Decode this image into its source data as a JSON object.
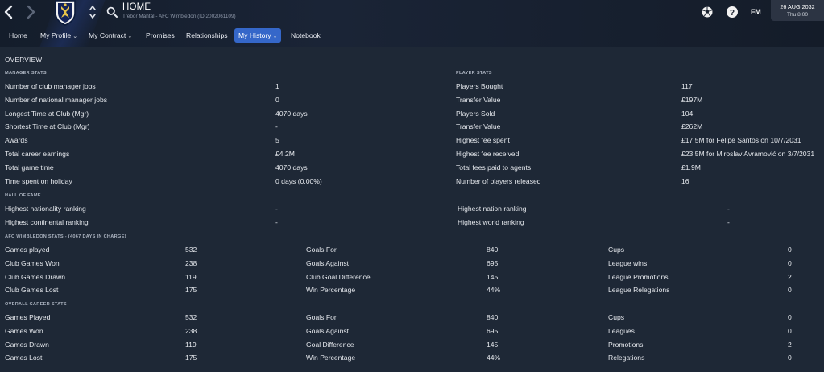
{
  "header": {
    "title": "HOME",
    "subtitle": "Trebor Mahtal - AFC Wimbledon (ID:2002061109)",
    "brand": "FM",
    "date": "26 AUG 2032",
    "time": "Thu 8:00"
  },
  "menu": [
    {
      "label": "Home",
      "dropdown": false
    },
    {
      "label": "My Profile",
      "dropdown": true
    },
    {
      "label": "My Contract",
      "dropdown": true
    },
    {
      "label": "Promises",
      "dropdown": false
    },
    {
      "label": "Relationships",
      "dropdown": false
    },
    {
      "label": "My History",
      "dropdown": true,
      "active": true
    },
    {
      "label": "Notebook",
      "dropdown": false
    }
  ],
  "overview": {
    "title": "OVERVIEW"
  },
  "manager_stats": {
    "title": "MANAGER STATS",
    "rows": [
      {
        "label": "Number of club manager jobs",
        "value": "1"
      },
      {
        "label": "Number of national manager jobs",
        "value": "0"
      },
      {
        "label": "Longest Time at Club (Mgr)",
        "value": "4070 days"
      },
      {
        "label": "Shortest Time at Club (Mgr)",
        "value": "-"
      },
      {
        "label": "Awards",
        "value": "5"
      },
      {
        "label": "Total career earnings",
        "value": "£4.2M"
      },
      {
        "label": "Total game time",
        "value": "4070 days"
      },
      {
        "label": "Time spent on holiday",
        "value": "0 days (0.00%)"
      }
    ]
  },
  "player_stats": {
    "title": "PLAYER STATS",
    "rows": [
      {
        "label": "Players Bought",
        "value": "117"
      },
      {
        "label": "Transfer Value",
        "value": "£197M"
      },
      {
        "label": "Players Sold",
        "value": "104"
      },
      {
        "label": "Transfer Value",
        "value": "£262M"
      },
      {
        "label": "Highest fee spent",
        "value": "£17.5M for Felipe Santos on 10/7/2031"
      },
      {
        "label": "Highest fee received",
        "value": "£23.5M for Miroslav Avramović on 3/7/2031"
      },
      {
        "label": "Total fees paid to agents",
        "value": "£1.9M"
      },
      {
        "label": "Number of players released",
        "value": "16"
      }
    ]
  },
  "hall_of_fame": {
    "title": "HALL OF FAME",
    "rows": [
      {
        "l1": "Highest nationality ranking",
        "v1": "-",
        "l2": "Highest nation ranking",
        "v2": "-"
      },
      {
        "l1": "Highest continental ranking",
        "v1": "-",
        "l2": "Highest world ranking",
        "v2": "-"
      }
    ]
  },
  "club_stats": {
    "title": "AFC WIMBLEDON STATS - (4067 DAYS IN CHARGE)",
    "rows": [
      {
        "l1": "Games played",
        "v1": "532",
        "l2": "Goals For",
        "v2": "840",
        "l3": "Cups",
        "v3": "0"
      },
      {
        "l1": "Club Games Won",
        "v1": "238",
        "l2": "Goals Against",
        "v2": "695",
        "l3": "League wins",
        "v3": "0"
      },
      {
        "l1": "Club Games Drawn",
        "v1": "119",
        "l2": "Club Goal Difference",
        "v2": "145",
        "l3": "League Promotions",
        "v3": "2"
      },
      {
        "l1": "Club Games Lost",
        "v1": "175",
        "l2": "Win Percentage",
        "v2": "44%",
        "l3": "League Relegations",
        "v3": "0"
      }
    ]
  },
  "career_stats": {
    "title": "OVERALL CAREER STATS",
    "rows": [
      {
        "l1": "Games Played",
        "v1": "532",
        "l2": "Goals For",
        "v2": "840",
        "l3": "Cups",
        "v3": "0"
      },
      {
        "l1": "Games Won",
        "v1": "238",
        "l2": "Goals Against",
        "v2": "695",
        "l3": "Leagues",
        "v3": "0"
      },
      {
        "l1": "Games Drawn",
        "v1": "119",
        "l2": "Goal Difference",
        "v2": "145",
        "l3": "Promotions",
        "v3": "2"
      },
      {
        "l1": "Games Lost",
        "v1": "175",
        "l2": "Win Percentage",
        "v2": "44%",
        "l3": "Relegations",
        "v3": "0"
      }
    ]
  },
  "icons": {
    "back": "chevron-left-icon",
    "forward": "chevron-right-icon",
    "crest": "club-crest-icon",
    "updown": "up-down-arrows-icon",
    "search": "search-icon",
    "ball": "football-icon",
    "help": "help-icon"
  },
  "colors": {
    "accent": "#3567c9",
    "background": "#1e2836",
    "header": "#141d2b"
  }
}
